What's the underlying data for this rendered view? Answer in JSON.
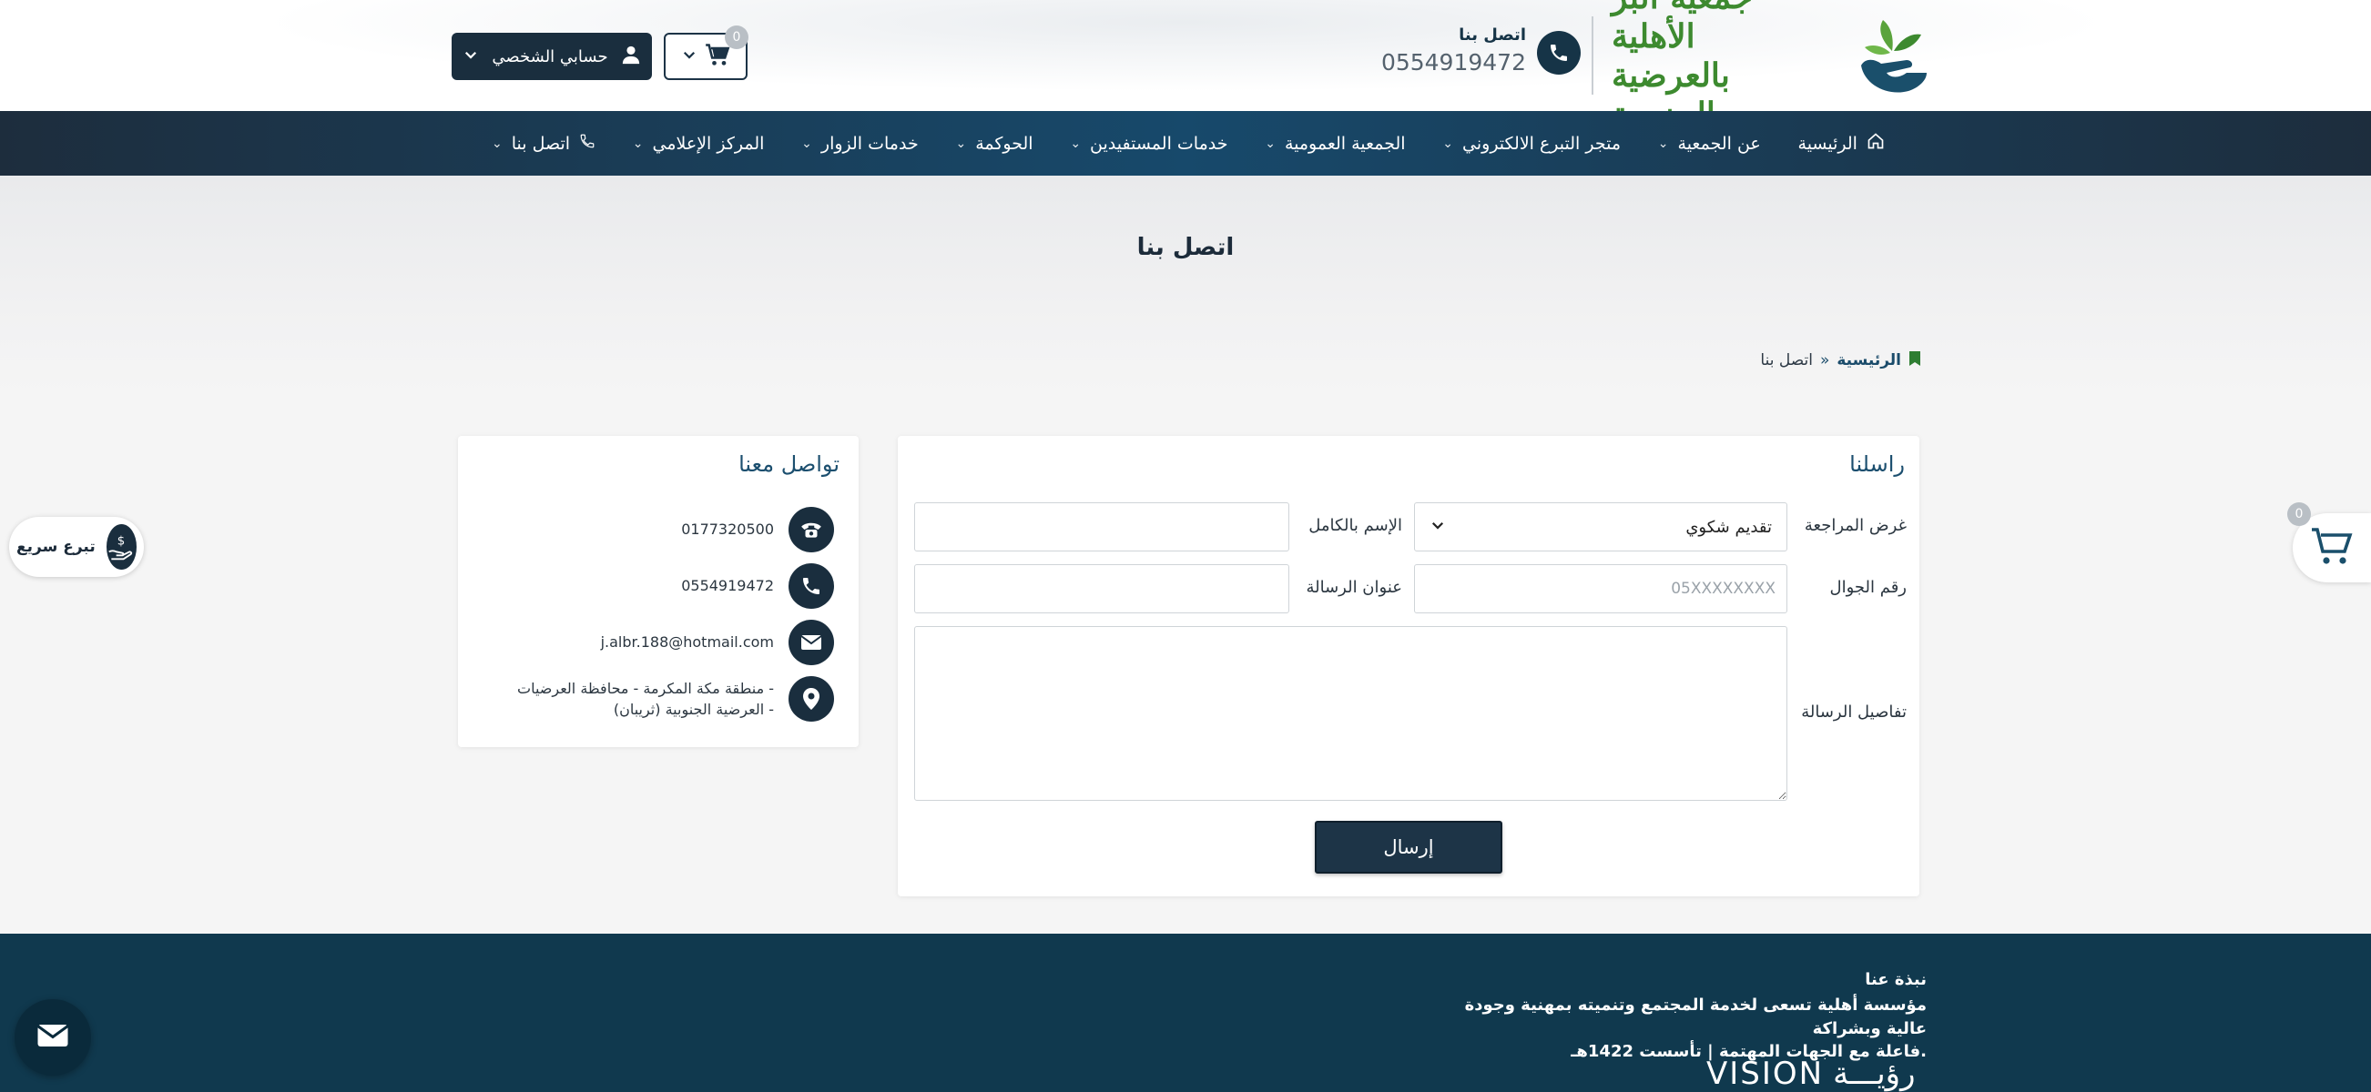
{
  "header": {
    "logo_line1": "جمعية البر الأهلية",
    "logo_line2": "بالعرضية الجنوبية",
    "contact_label": "اتصل بنا",
    "contact_phone": "0554919472",
    "cart_count": "0",
    "account_label": "حسابي الشخصي"
  },
  "nav": {
    "items": [
      {
        "label": "الرئيسية"
      },
      {
        "label": "عن الجمعية"
      },
      {
        "label": "متجر التبرع الالكتروني"
      },
      {
        "label": "الجمعية العمومية"
      },
      {
        "label": "خدمات المستفيدين"
      },
      {
        "label": "الحوكمة"
      },
      {
        "label": "خدمات الزوار"
      },
      {
        "label": "المركز الإعلامي"
      },
      {
        "label": "اتصل بنا"
      }
    ]
  },
  "page": {
    "title": "اتصل بنا",
    "breadcrumb_home": "الرئيسية",
    "breadcrumb_sep": "»",
    "breadcrumb_current": "اتصل بنا"
  },
  "form": {
    "title": "راسلنا",
    "purpose_label": "غرض المراجعة",
    "purpose_value": "تقديم شكوي",
    "name_label": "الإسم بالكامل",
    "name_value": "",
    "mobile_label": "رقم الجوال",
    "mobile_placeholder": "05XXXXXXXX",
    "subject_label": "عنوان الرسالة",
    "subject_value": "",
    "details_label": "تفاصيل الرسالة",
    "submit_label": "إرسال"
  },
  "contact": {
    "title": "تواصل معنا",
    "phone1": "0177320500",
    "phone2": "0554919472",
    "email": "j.albr.188@hotmail.com",
    "address_line1": "منطقة مكة المكرمة - محافظة العرضيات -",
    "address_line2": "العرضية الجنوبية (ثريبان) -"
  },
  "floating": {
    "side_cart_count": "0",
    "quick_donate_label": "تبرع سريع"
  },
  "footer": {
    "about_title": "نبذة عنا",
    "about_line1": "مؤسسة أهلية تسعى لخدمة المجتمع وتنميته بمهنية وجودة عالية وبشراكة",
    "about_line2": "فاعلة مع الجهات المهتمة | تأسست 1422هـ.",
    "vision_en": "VISION",
    "vision_ar": "رؤيـــة"
  },
  "colors": {
    "primary_dark": "#1a2e3e",
    "nav_mid": "#17496b",
    "footer_bg": "#10394e",
    "logo_green": "#3d8a2f"
  }
}
